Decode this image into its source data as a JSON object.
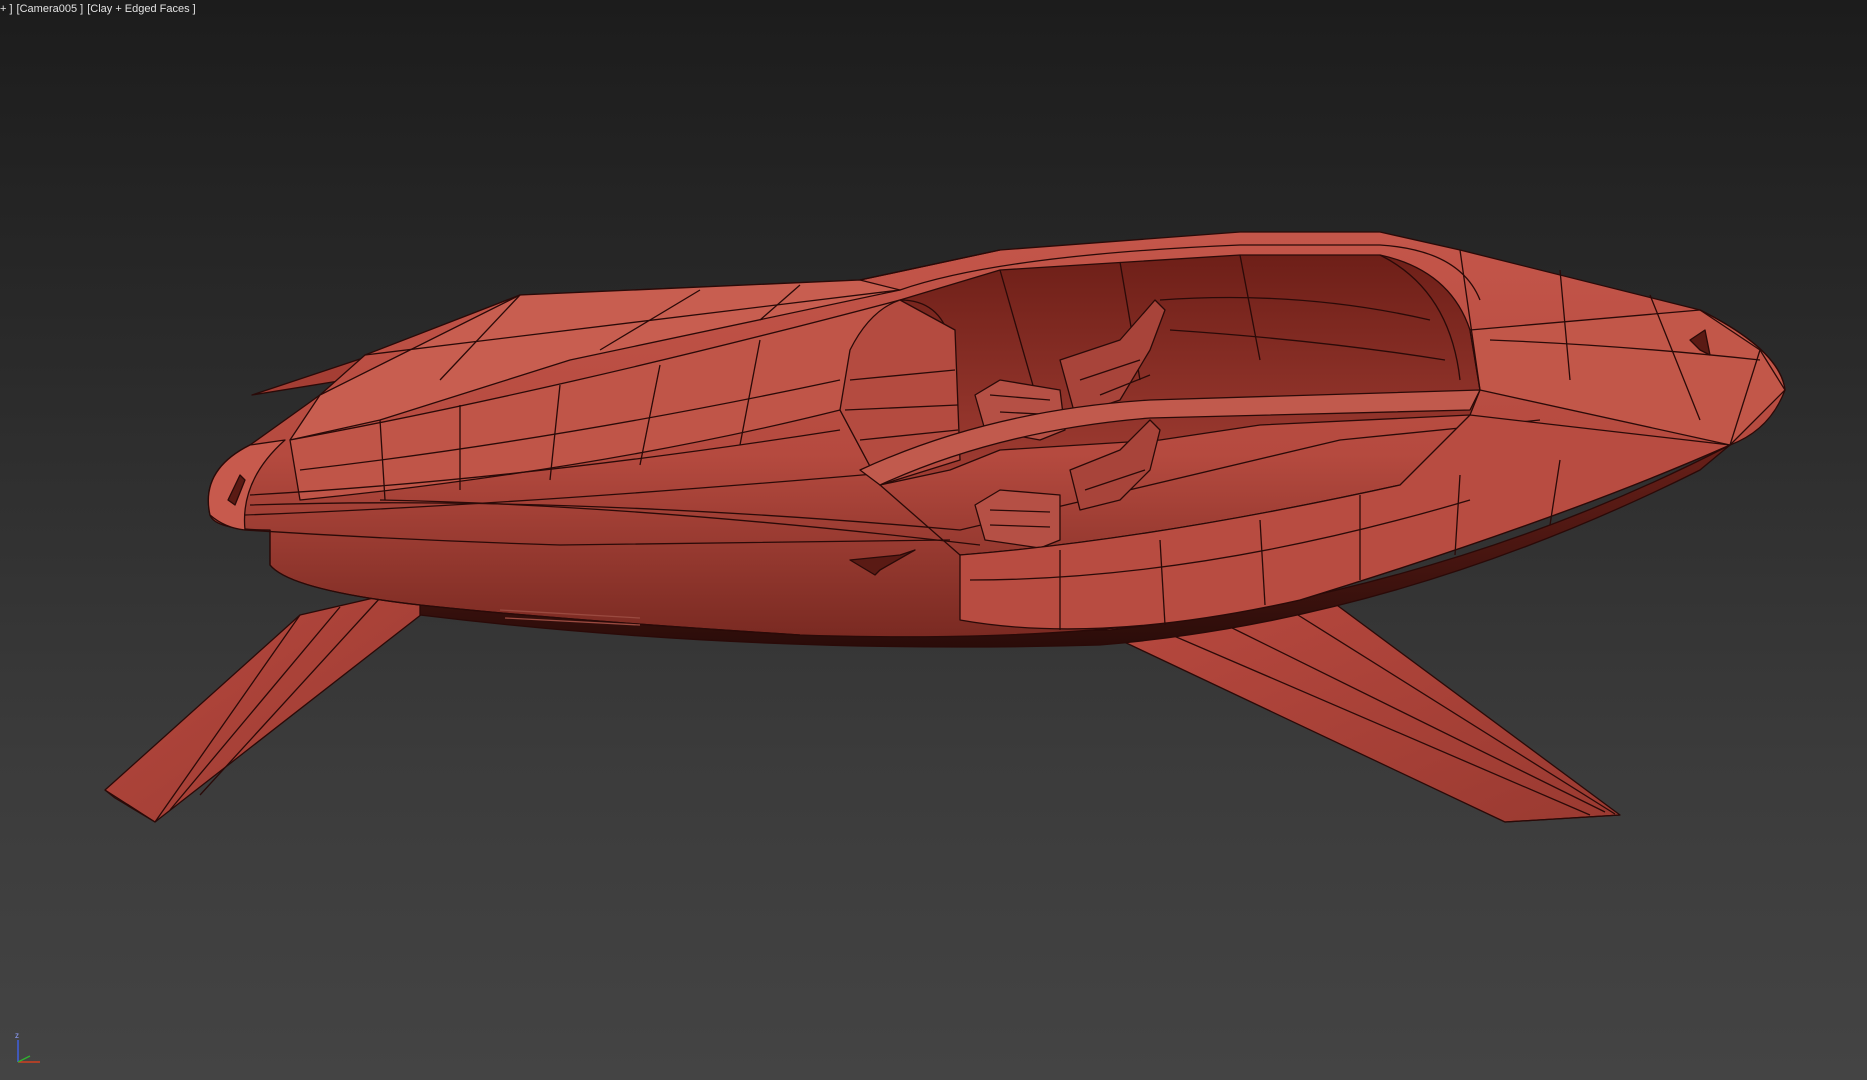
{
  "viewport": {
    "label_plus": "+ ]",
    "label_camera": "[Camera005 ]",
    "label_shading": "[Clay + Edged Faces ]",
    "background_top": "#1c1c1c",
    "background_bottom": "#444444"
  },
  "model": {
    "description_color": "#b5493e",
    "edge_color": "#2a0a08"
  },
  "gizmo": {
    "axis_z_label": "z",
    "axis_x_color": "#d04020",
    "axis_y_color": "#30b030",
    "axis_z_color": "#4060e0"
  }
}
